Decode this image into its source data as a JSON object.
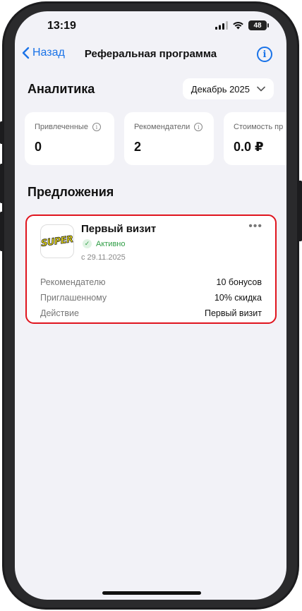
{
  "status_bar": {
    "time": "13:19",
    "battery": "48",
    "icons": [
      "signal-icon",
      "wifi-icon",
      "battery-icon"
    ]
  },
  "nav": {
    "back_label": "Назад",
    "title": "Реферальная программа",
    "info_icon": "info-icon"
  },
  "analytics": {
    "title": "Аналитика",
    "month": "Декабрь 2025",
    "stats": [
      {
        "label": "Привлеченные",
        "value": "0"
      },
      {
        "label": "Рекомендатели",
        "value": "2"
      },
      {
        "label": "Стоимость пр",
        "value": "0.0 ₽"
      }
    ]
  },
  "offers": {
    "title": "Предложения",
    "items": [
      {
        "logo_text": "SUPER",
        "name": "Первый визит",
        "status": "Активно",
        "date": "с 29.11.2025",
        "details": [
          {
            "key": "Рекомендателю",
            "value": "10 бонусов"
          },
          {
            "key": "Приглашенному",
            "value": "10% скидка"
          },
          {
            "key": "Действие",
            "value": "Первый визит"
          }
        ]
      }
    ]
  },
  "colors": {
    "accent": "#1a73e8",
    "highlight_border": "#e0141e",
    "status_active": "#2e9d44",
    "background": "#f2f2f7"
  }
}
